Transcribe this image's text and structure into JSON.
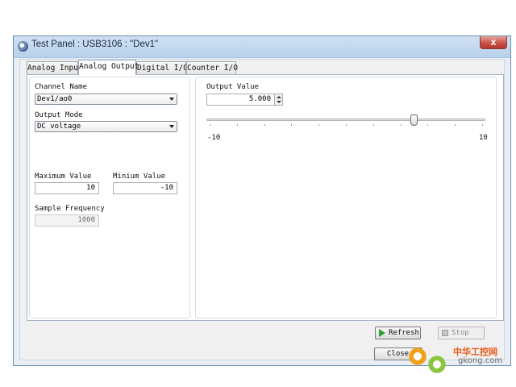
{
  "window": {
    "title": "Test Panel : USB3106 : \"Dev1\"",
    "close_glyph": "x"
  },
  "tabs": [
    {
      "label": "Analog Input",
      "active": false
    },
    {
      "label": "Analog Output",
      "active": true
    },
    {
      "label": "Digital I/O",
      "active": false
    },
    {
      "label": "Counter I/O",
      "active": false
    }
  ],
  "left_panel": {
    "channel_name_label": "Channel Name",
    "channel_name_value": "Dev1/ao0",
    "output_mode_label": "Output Mode",
    "output_mode_value": "DC voltage",
    "maximum_value_label": "Maximum Value",
    "maximum_value": "10",
    "minimum_value_label": "Minium Value",
    "minimum_value": "-10",
    "sample_frequency_label": "Sample Frequency",
    "sample_frequency_value": "1000"
  },
  "right_panel": {
    "output_value_label": "Output Value",
    "output_value": "5.000",
    "slider_min_label": "-10",
    "slider_max_label": "10",
    "slider_min": -10,
    "slider_max": 10,
    "slider_value": 5
  },
  "buttons": {
    "refresh": "Refresh",
    "stop": "Stop",
    "close": "Close"
  },
  "watermark": {
    "chinese": "中华工控网",
    "url": "gkong.com"
  },
  "icons": {
    "app": "panel-icon",
    "refresh": "play-icon",
    "stop": "stop-icon"
  },
  "colors": {
    "refresh_icon": "#2fa12f",
    "watermark_orange": "#e85a1c"
  }
}
